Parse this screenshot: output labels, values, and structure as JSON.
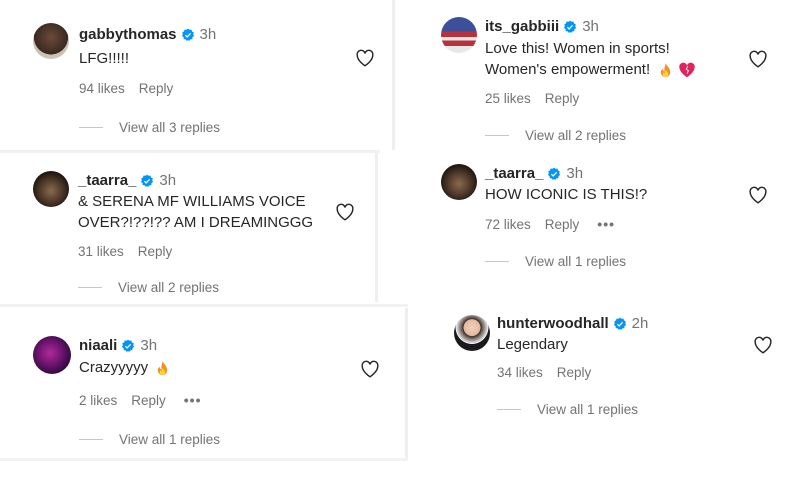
{
  "comments": [
    {
      "username": "gabbythomas",
      "time": "3h",
      "text": [
        "LFG!!!!!"
      ],
      "likes": "94 likes",
      "reply": "Reply",
      "replies": "View all 3 replies",
      "show_more": false,
      "emoji": ""
    },
    {
      "username": "its_gabbiii",
      "time": "3h",
      "text": [
        "Love this! Women in sports!",
        "Women's empowerment!"
      ],
      "likes": "25 likes",
      "reply": "Reply",
      "replies": "View all 2 replies",
      "show_more": false,
      "emoji": "fire-heart"
    },
    {
      "username": "_taarra_",
      "time": "3h",
      "text": [
        "& SERENA MF WILLIAMS VOICE",
        "OVER?!??!?? AM I DREAMINGGG"
      ],
      "likes": "31 likes",
      "reply": "Reply",
      "replies": "View all 2 replies",
      "show_more": false,
      "emoji": ""
    },
    {
      "username": "_taarra_",
      "time": "3h",
      "text": [
        "HOW ICONIC IS THIS!?"
      ],
      "likes": "72 likes",
      "reply": "Reply",
      "replies": "View all 1 replies",
      "show_more": true,
      "emoji": ""
    },
    {
      "username": "niaali",
      "time": "3h",
      "text": [
        "Crazyyyyy"
      ],
      "likes": "2 likes",
      "reply": "Reply",
      "replies": "View all 1 replies",
      "show_more": true,
      "emoji": "fire"
    },
    {
      "username": "hunterwoodhall",
      "time": "2h",
      "text": [
        "Legendary"
      ],
      "likes": "34 likes",
      "reply": "Reply",
      "replies": "View all 1 replies",
      "show_more": false,
      "emoji": ""
    }
  ],
  "more_glyph": "•••",
  "colors": {
    "verified": "#0095f6",
    "secondary": "#737373",
    "text": "#262626"
  }
}
